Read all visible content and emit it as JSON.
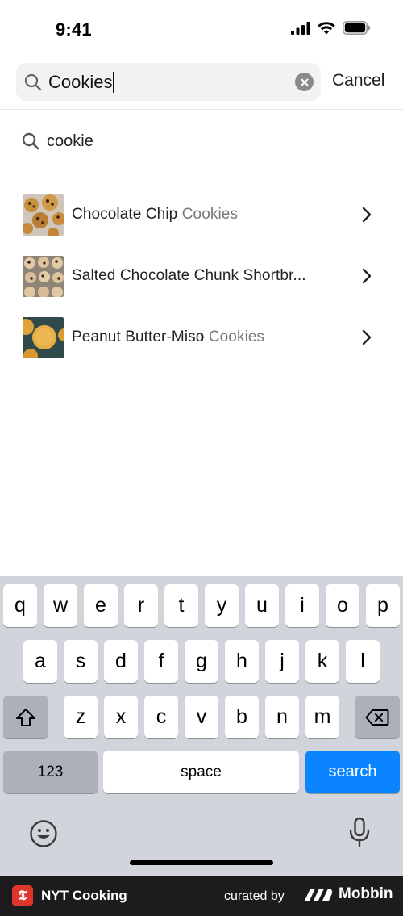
{
  "status_bar": {
    "time": "9:41"
  },
  "search": {
    "value": "Cookies",
    "clear_icon": "clear-circle-icon",
    "cancel_label": "Cancel"
  },
  "suggestion": {
    "text": "cookie",
    "icon": "search-icon"
  },
  "results": [
    {
      "title_main": "Chocolate Chip ",
      "title_muted": "Cookies"
    },
    {
      "title_main": "Salted Chocolate Chunk Shortbr...",
      "title_muted": ""
    },
    {
      "title_main": "Peanut Butter-Miso ",
      "title_muted": "Cookies"
    }
  ],
  "keyboard": {
    "row1": [
      "q",
      "w",
      "e",
      "r",
      "t",
      "y",
      "u",
      "i",
      "o",
      "p"
    ],
    "row2": [
      "a",
      "s",
      "d",
      "f",
      "g",
      "h",
      "j",
      "k",
      "l"
    ],
    "row3": [
      "z",
      "x",
      "c",
      "v",
      "b",
      "n",
      "m"
    ],
    "numbers_label": "123",
    "space_label": "space",
    "search_label": "search",
    "accent_color": "#0a84ff"
  },
  "footer": {
    "app_name": "NYT Cooking",
    "logo_letter": "𝕿",
    "curated_by": "curated by",
    "brand": "Mobbin"
  }
}
